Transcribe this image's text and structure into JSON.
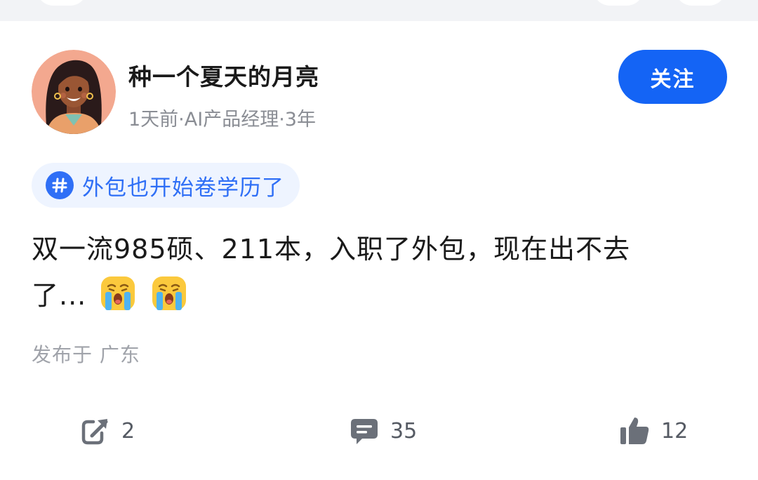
{
  "post": {
    "author": {
      "name": "种一个夏天的月亮",
      "meta": "1天前·AI产品经理·3年",
      "avatar_icon": "woman-avatar-icon"
    },
    "follow_label": "关注",
    "topic": {
      "icon": "hashtag-icon",
      "label": "外包也开始卷学历了"
    },
    "content": {
      "line1": "双一流985硕、211本，入职了外包，现在出不去",
      "line2": "了...",
      "emojis": [
        "crying-face-icon",
        "crying-face-icon"
      ]
    },
    "location": "发布于 广东",
    "actions": {
      "share": {
        "icon": "share-icon",
        "count": "2"
      },
      "comment": {
        "icon": "comment-icon",
        "count": "35"
      },
      "like": {
        "icon": "thumbs-up-icon",
        "count": "12"
      }
    }
  },
  "colors": {
    "accent": "#1464f5",
    "topic_text": "#2f6ff6",
    "topic_bg": "#eef4ff",
    "meta_text": "#8a8d94",
    "location_text": "#a0a3aa",
    "body_text": "#1a1a1a"
  }
}
